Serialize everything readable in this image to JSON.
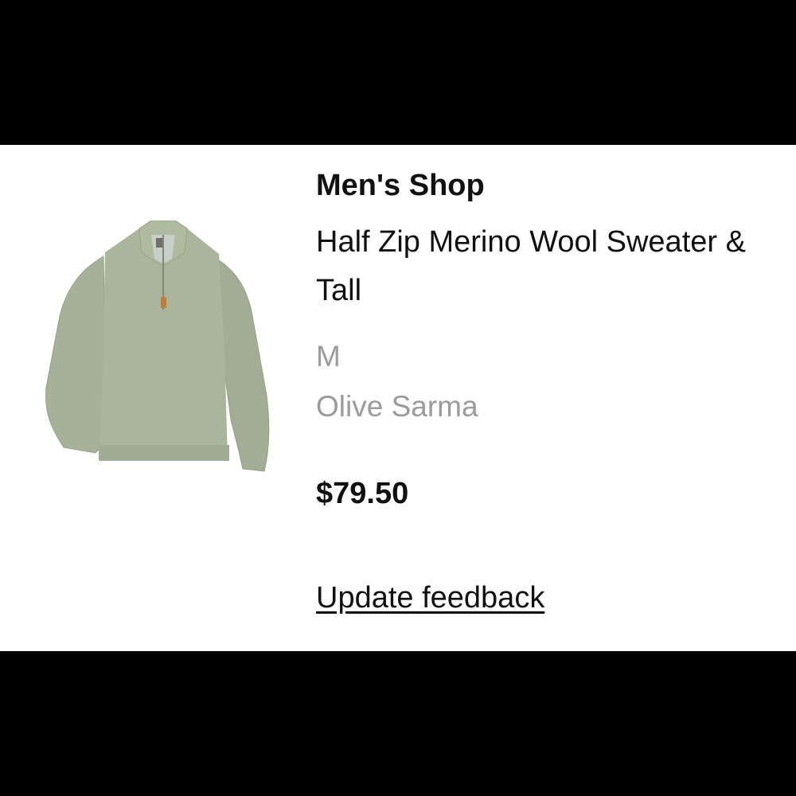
{
  "item": {
    "brand": "Men's Shop",
    "title": "Half Zip Merino Wool Sweater & Tall",
    "size": "M",
    "color_name": "Olive Sarma",
    "price": "$79.50",
    "image_icon": "sweater-icon"
  },
  "actions": {
    "update_feedback_label": "Update feedback"
  },
  "colors": {
    "background": "#ffffff",
    "letterbox": "#000000",
    "primary_text": "#111111",
    "secondary_text": "#9b9b9b",
    "sweater": "#a9b39a"
  }
}
